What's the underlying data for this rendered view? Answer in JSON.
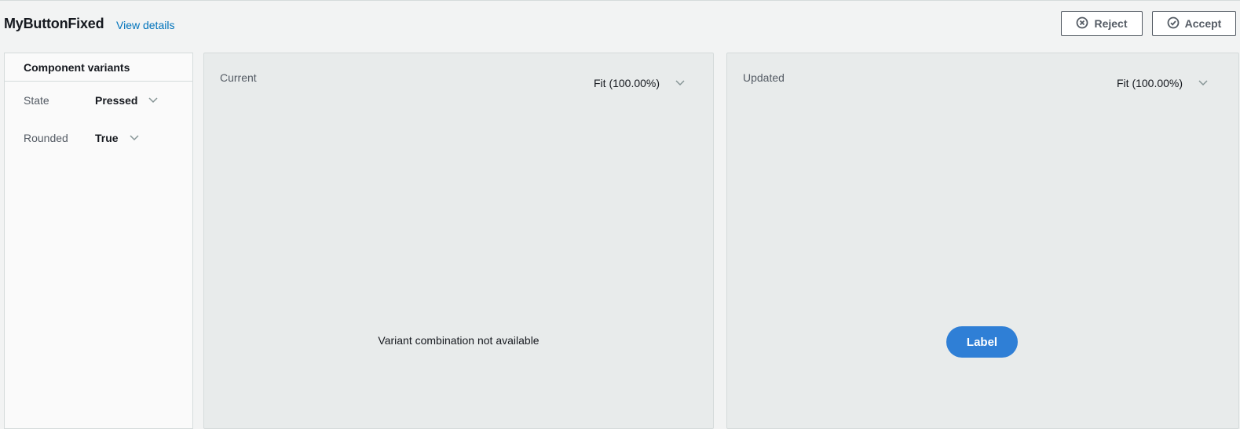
{
  "header": {
    "title": "MyButtonFixed",
    "view_details": "View details",
    "reject_label": "Reject",
    "accept_label": "Accept",
    "reject_icon": "circle-x-icon",
    "accept_icon": "circle-check-icon"
  },
  "sidebar": {
    "heading": "Component variants",
    "variants": [
      {
        "label": "State",
        "value": "Pressed"
      },
      {
        "label": "Rounded",
        "value": "True"
      }
    ]
  },
  "panels": {
    "current": {
      "label": "Current",
      "zoom": "Fit (100.00%)",
      "message": "Variant combination not available"
    },
    "updated": {
      "label": "Updated",
      "zoom": "Fit (100.00%)",
      "preview_button_label": "Label"
    }
  },
  "colors": {
    "link": "#0073bb",
    "preview_button": "#2f7fd6",
    "panel_bg": "#e8ebeb",
    "page_bg": "#f2f3f3"
  }
}
